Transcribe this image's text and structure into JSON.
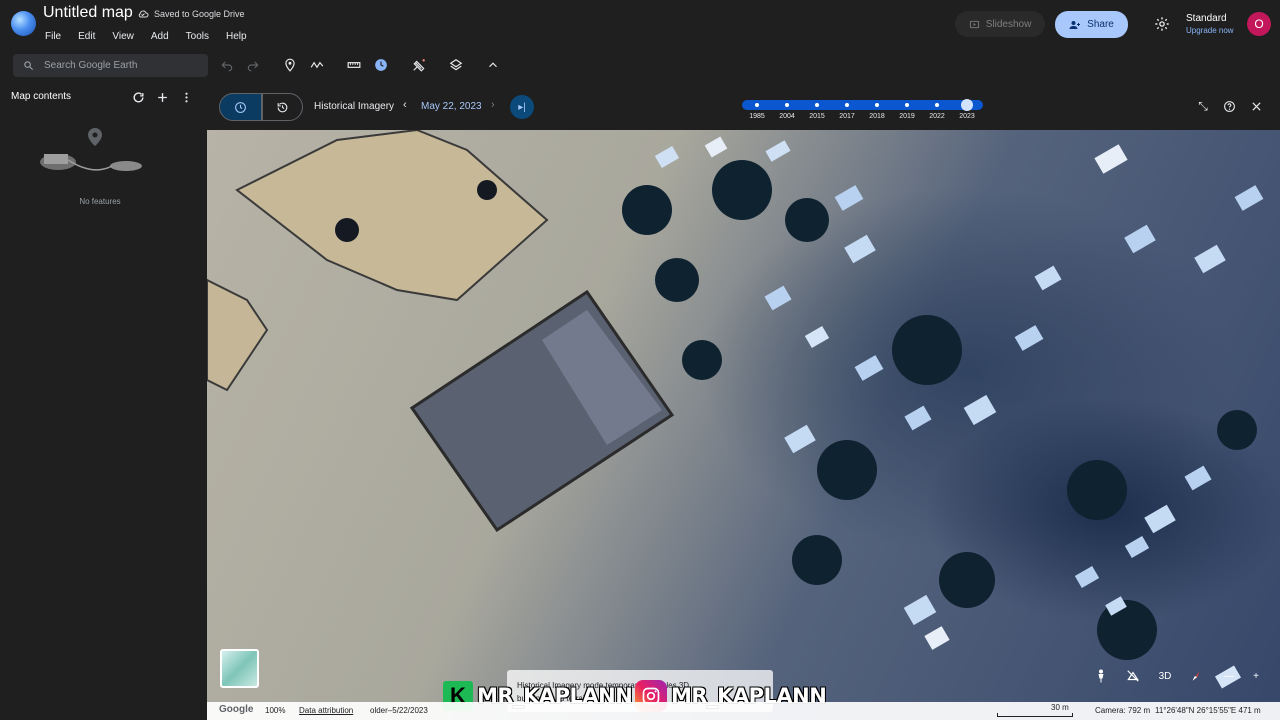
{
  "header": {
    "title": "Untitled map",
    "saved_status": "Saved to Google Drive",
    "menu": [
      "File",
      "Edit",
      "View",
      "Add",
      "Tools",
      "Help"
    ],
    "slideshow_label": "Slideshow",
    "share_label": "Share",
    "plan_name": "Standard",
    "upgrade_label": "Upgrade now",
    "avatar_letter": "O"
  },
  "toolbar": {
    "search_placeholder": "Search Google Earth",
    "tools": [
      "undo-icon",
      "redo-icon",
      "placemark-icon",
      "path-icon",
      "ruler-icon",
      "historical-imagery-icon",
      "satellite-icon",
      "layers-icon",
      "collapse-up-icon"
    ]
  },
  "left_panel": {
    "title": "Map contents",
    "empty_text": "No features"
  },
  "historical_bar": {
    "label": "Historical Imagery",
    "date": "May 22, 2023",
    "timeline_years": [
      "1985",
      "2004",
      "2015",
      "2017",
      "2018",
      "2019",
      "2022",
      "2023"
    ],
    "selected_year": "2023"
  },
  "status_bar": {
    "brand": "Google",
    "zoom": "100%",
    "attribution": "Data attribution",
    "imagery_date": "older–5/22/2023",
    "scale": "30 m",
    "camera": "Camera: 792 m",
    "coordinates": "11°26'48\"N 26°15'55\"E  471 m"
  },
  "map_controls": {
    "view_mode": "3D"
  },
  "toast": {
    "line1": "Historical Imagery mode temporarily disables 3D",
    "line2": "buildings and terrain."
  },
  "watermark": {
    "handle1": "MR_KAPLANN",
    "handle2": "MR_KAPLANN"
  },
  "colors": {
    "accent": "#a8c7fa",
    "timeline": "#0b57d0",
    "background": "#1f1f1f"
  }
}
